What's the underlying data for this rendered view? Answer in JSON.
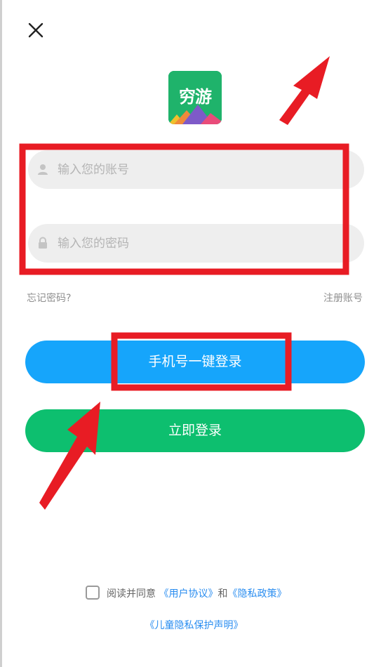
{
  "header": {
    "close_icon": "close-icon"
  },
  "logo": {
    "text": "穷游",
    "colors": {
      "bg": "#1fb36b",
      "mountain1": "#7e5ac8",
      "mountain2": "#f0c02c",
      "mountain3": "#f08a3a",
      "mountain4": "#e94c7a"
    }
  },
  "form": {
    "account": {
      "placeholder": "输入您的账号",
      "value": "",
      "icon": "user-icon"
    },
    "password": {
      "placeholder": "输入您的密码",
      "value": "",
      "icon": "lock-icon"
    }
  },
  "links": {
    "forgot": "忘记密码?",
    "register": "注册账号"
  },
  "buttons": {
    "phone_login": "手机号一键登录",
    "login": "立即登录"
  },
  "agreement": {
    "prefix": "阅读并同意",
    "user_agreement": "《用户协议》",
    "and": "和",
    "privacy": "《隐私政策》",
    "children_privacy": "《儿童隐私保护声明》",
    "checked": false
  },
  "colors": {
    "phone_button": "#16a5fb",
    "login_button": "#0dbf6f",
    "link_blue": "#2a8df0",
    "annotation_red": "#e81c24"
  }
}
